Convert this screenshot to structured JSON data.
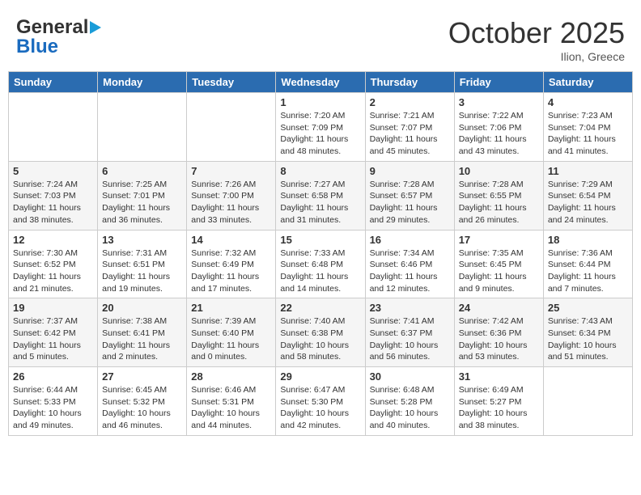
{
  "header": {
    "logo_general": "General",
    "logo_blue": "Blue",
    "month": "October 2025",
    "location": "Ilion, Greece"
  },
  "weekdays": [
    "Sunday",
    "Monday",
    "Tuesday",
    "Wednesday",
    "Thursday",
    "Friday",
    "Saturday"
  ],
  "weeks": [
    [
      {
        "day": "",
        "info": ""
      },
      {
        "day": "",
        "info": ""
      },
      {
        "day": "",
        "info": ""
      },
      {
        "day": "1",
        "info": "Sunrise: 7:20 AM\nSunset: 7:09 PM\nDaylight: 11 hours and 48 minutes."
      },
      {
        "day": "2",
        "info": "Sunrise: 7:21 AM\nSunset: 7:07 PM\nDaylight: 11 hours and 45 minutes."
      },
      {
        "day": "3",
        "info": "Sunrise: 7:22 AM\nSunset: 7:06 PM\nDaylight: 11 hours and 43 minutes."
      },
      {
        "day": "4",
        "info": "Sunrise: 7:23 AM\nSunset: 7:04 PM\nDaylight: 11 hours and 41 minutes."
      }
    ],
    [
      {
        "day": "5",
        "info": "Sunrise: 7:24 AM\nSunset: 7:03 PM\nDaylight: 11 hours and 38 minutes."
      },
      {
        "day": "6",
        "info": "Sunrise: 7:25 AM\nSunset: 7:01 PM\nDaylight: 11 hours and 36 minutes."
      },
      {
        "day": "7",
        "info": "Sunrise: 7:26 AM\nSunset: 7:00 PM\nDaylight: 11 hours and 33 minutes."
      },
      {
        "day": "8",
        "info": "Sunrise: 7:27 AM\nSunset: 6:58 PM\nDaylight: 11 hours and 31 minutes."
      },
      {
        "day": "9",
        "info": "Sunrise: 7:28 AM\nSunset: 6:57 PM\nDaylight: 11 hours and 29 minutes."
      },
      {
        "day": "10",
        "info": "Sunrise: 7:28 AM\nSunset: 6:55 PM\nDaylight: 11 hours and 26 minutes."
      },
      {
        "day": "11",
        "info": "Sunrise: 7:29 AM\nSunset: 6:54 PM\nDaylight: 11 hours and 24 minutes."
      }
    ],
    [
      {
        "day": "12",
        "info": "Sunrise: 7:30 AM\nSunset: 6:52 PM\nDaylight: 11 hours and 21 minutes."
      },
      {
        "day": "13",
        "info": "Sunrise: 7:31 AM\nSunset: 6:51 PM\nDaylight: 11 hours and 19 minutes."
      },
      {
        "day": "14",
        "info": "Sunrise: 7:32 AM\nSunset: 6:49 PM\nDaylight: 11 hours and 17 minutes."
      },
      {
        "day": "15",
        "info": "Sunrise: 7:33 AM\nSunset: 6:48 PM\nDaylight: 11 hours and 14 minutes."
      },
      {
        "day": "16",
        "info": "Sunrise: 7:34 AM\nSunset: 6:46 PM\nDaylight: 11 hours and 12 minutes."
      },
      {
        "day": "17",
        "info": "Sunrise: 7:35 AM\nSunset: 6:45 PM\nDaylight: 11 hours and 9 minutes."
      },
      {
        "day": "18",
        "info": "Sunrise: 7:36 AM\nSunset: 6:44 PM\nDaylight: 11 hours and 7 minutes."
      }
    ],
    [
      {
        "day": "19",
        "info": "Sunrise: 7:37 AM\nSunset: 6:42 PM\nDaylight: 11 hours and 5 minutes."
      },
      {
        "day": "20",
        "info": "Sunrise: 7:38 AM\nSunset: 6:41 PM\nDaylight: 11 hours and 2 minutes."
      },
      {
        "day": "21",
        "info": "Sunrise: 7:39 AM\nSunset: 6:40 PM\nDaylight: 11 hours and 0 minutes."
      },
      {
        "day": "22",
        "info": "Sunrise: 7:40 AM\nSunset: 6:38 PM\nDaylight: 10 hours and 58 minutes."
      },
      {
        "day": "23",
        "info": "Sunrise: 7:41 AM\nSunset: 6:37 PM\nDaylight: 10 hours and 56 minutes."
      },
      {
        "day": "24",
        "info": "Sunrise: 7:42 AM\nSunset: 6:36 PM\nDaylight: 10 hours and 53 minutes."
      },
      {
        "day": "25",
        "info": "Sunrise: 7:43 AM\nSunset: 6:34 PM\nDaylight: 10 hours and 51 minutes."
      }
    ],
    [
      {
        "day": "26",
        "info": "Sunrise: 6:44 AM\nSunset: 5:33 PM\nDaylight: 10 hours and 49 minutes."
      },
      {
        "day": "27",
        "info": "Sunrise: 6:45 AM\nSunset: 5:32 PM\nDaylight: 10 hours and 46 minutes."
      },
      {
        "day": "28",
        "info": "Sunrise: 6:46 AM\nSunset: 5:31 PM\nDaylight: 10 hours and 44 minutes."
      },
      {
        "day": "29",
        "info": "Sunrise: 6:47 AM\nSunset: 5:30 PM\nDaylight: 10 hours and 42 minutes."
      },
      {
        "day": "30",
        "info": "Sunrise: 6:48 AM\nSunset: 5:28 PM\nDaylight: 10 hours and 40 minutes."
      },
      {
        "day": "31",
        "info": "Sunrise: 6:49 AM\nSunset: 5:27 PM\nDaylight: 10 hours and 38 minutes."
      },
      {
        "day": "",
        "info": ""
      }
    ]
  ]
}
